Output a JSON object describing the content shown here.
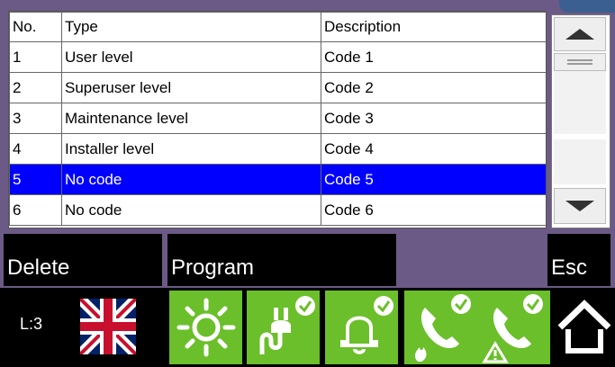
{
  "table": {
    "headers": {
      "no": "No.",
      "type": "Type",
      "description": "Description"
    },
    "rows": [
      {
        "no": "1",
        "type": "User level",
        "description": "Code 1"
      },
      {
        "no": "2",
        "type": "Superuser level",
        "description": "Code 2"
      },
      {
        "no": "3",
        "type": "Maintenance level",
        "description": "Code 3"
      },
      {
        "no": "4",
        "type": "Installer level",
        "description": "Code 4"
      },
      {
        "no": "5",
        "type": "No code",
        "description": "Code 5"
      },
      {
        "no": "6",
        "type": "No code",
        "description": "Code 6"
      }
    ],
    "selected_row": 5
  },
  "actions": {
    "delete_label": "Delete",
    "program_label": "Program",
    "esc_label": "Esc"
  },
  "status": {
    "level_label": "L:3",
    "language_flag": "uk-flag-icon",
    "icons": [
      "sun-icon",
      "power-plug-check-icon",
      "bell-check-icon",
      "phone-fire-check-icon",
      "phone-warning-check-icon",
      "home-icon"
    ]
  },
  "colors": {
    "background": "#6b5a86",
    "selected_row": "#0000ff",
    "status_tile": "#6bbf2a"
  }
}
